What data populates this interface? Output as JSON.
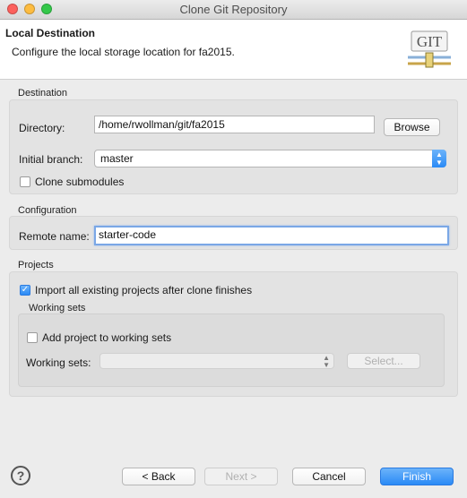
{
  "window": {
    "title": "Clone Git Repository"
  },
  "header": {
    "title": "Local Destination",
    "subtitle": "Configure the local storage location for fa2015.",
    "logo_text": "GIT"
  },
  "destination": {
    "group_label": "Destination",
    "directory_label": "Directory:",
    "directory_value": "/home/rwollman/git/fa2015",
    "browse_label": "Browse",
    "branch_label": "Initial branch:",
    "branch_value": "master",
    "clone_submodules_label": "Clone submodules",
    "clone_submodules_checked": false
  },
  "configuration": {
    "group_label": "Configuration",
    "remote_label": "Remote name:",
    "remote_value": "starter-code"
  },
  "projects": {
    "group_label": "Projects",
    "import_label": "Import all existing projects after clone finishes",
    "import_checked": true,
    "working_sets": {
      "group_label": "Working sets",
      "add_label": "Add project to working sets",
      "add_checked": false,
      "sets_label": "Working sets:",
      "sets_value": "",
      "select_label": "Select..."
    }
  },
  "footer": {
    "help_glyph": "?",
    "back_label": "< Back",
    "next_label": "Next >",
    "cancel_label": "Cancel",
    "finish_label": "Finish"
  },
  "colors": {
    "accent": "#2a8af6",
    "focus_ring": "#7aa7e6",
    "close": "#fc605c",
    "minimize": "#fdbc40",
    "maximize": "#34c84a"
  }
}
